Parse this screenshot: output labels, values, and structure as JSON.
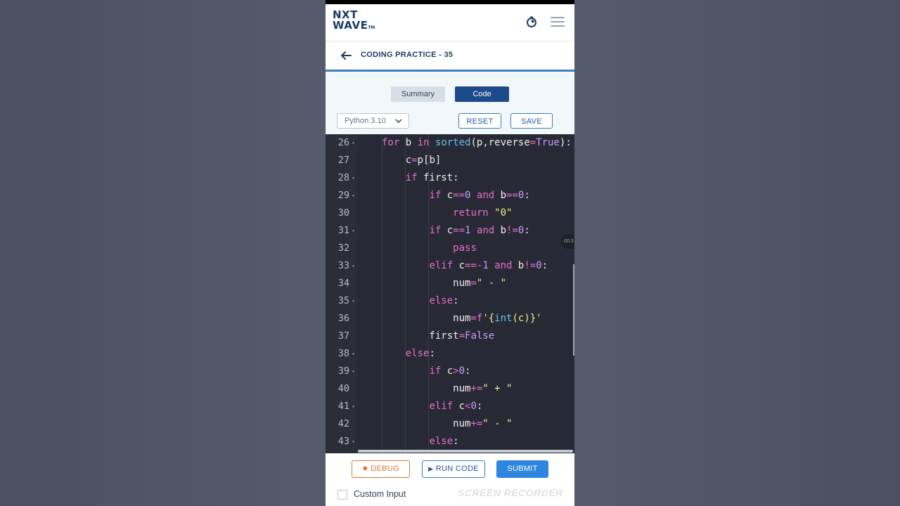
{
  "header": {
    "logo_line1": "NXT",
    "logo_line2": "WAVE",
    "logo_tm": "TM"
  },
  "subheader": {
    "title": "CODING PRACTICE - 35"
  },
  "tabs": [
    {
      "label": "Summary",
      "active": false
    },
    {
      "label": "Code",
      "active": true
    }
  ],
  "toolbar": {
    "language": "Python 3.10",
    "reset_label": "RESET",
    "save_label": "SAVE"
  },
  "editor": {
    "recording_badge": "00:3",
    "lines": [
      {
        "n": "26",
        "fold": true
      },
      {
        "n": "27",
        "fold": false
      },
      {
        "n": "28",
        "fold": true
      },
      {
        "n": "29",
        "fold": true
      },
      {
        "n": "30",
        "fold": false
      },
      {
        "n": "31",
        "fold": true
      },
      {
        "n": "32",
        "fold": false
      },
      {
        "n": "33",
        "fold": true
      },
      {
        "n": "34",
        "fold": false
      },
      {
        "n": "35",
        "fold": true
      },
      {
        "n": "36",
        "fold": false
      },
      {
        "n": "37",
        "fold": false
      },
      {
        "n": "38",
        "fold": true
      },
      {
        "n": "39",
        "fold": true
      },
      {
        "n": "40",
        "fold": false
      },
      {
        "n": "41",
        "fold": true
      },
      {
        "n": "42",
        "fold": false
      },
      {
        "n": "43",
        "fold": true
      }
    ]
  },
  "footer": {
    "debug_label": "DEBUG",
    "run_label": "RUN CODE",
    "submit_label": "SUBMIT",
    "custom_input_label": "Custom Input",
    "watermark": "SCREEN RECORDER"
  },
  "colors": {
    "brand": "#1b3a6b",
    "accent": "#2f86e0",
    "debug": "#e0752f",
    "editor_bg": "#272935"
  }
}
